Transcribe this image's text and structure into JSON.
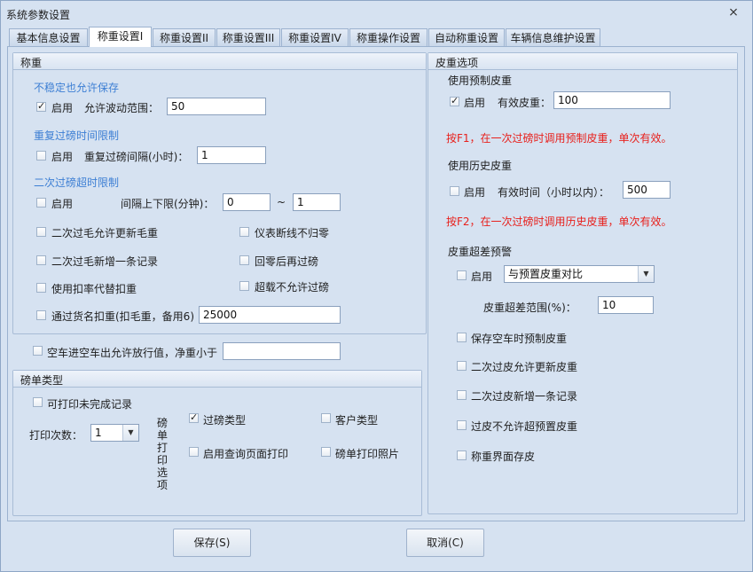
{
  "window": {
    "title": "系统参数设置",
    "close": "⨯"
  },
  "tabs": [
    "基本信息设置",
    "称重设置I",
    "称重设置II",
    "称重设置III",
    "称重设置IV",
    "称重操作设置",
    "自动称重设置",
    "车辆信息维护设置"
  ],
  "weighing": {
    "title": "称重",
    "unstable": {
      "heading": "不稳定也允许保存",
      "enable_label": "启用",
      "enabled": true,
      "range_label": "允许波动范围：",
      "range_value": "50"
    },
    "repeat": {
      "heading": "重复过磅时间限制",
      "enable_label": "启用",
      "enabled": false,
      "interval_label": "重复过磅间隔(小时)：",
      "interval_value": "1"
    },
    "second": {
      "heading": "二次过磅超时限制",
      "enable_label": "启用",
      "enabled": false,
      "range_label": "间隔上下限(分钟)：",
      "min_value": "0",
      "tilde": "~",
      "max_value": "1"
    },
    "options": {
      "update_gross": "二次过毛允许更新毛重",
      "new_gross_record": "二次过毛新增一条记录",
      "use_deduction_rate": "使用扣率代替扣重",
      "deduct_by_goods": "通过货名扣重(扣毛重，备用6)",
      "deduct_by_goods_value": "25000",
      "meter_disconnect": "仪表断线不归零",
      "rezero_then_weigh": "回零后再过磅",
      "overload_forbid": "超载不允许过磅"
    }
  },
  "empty_vehicle": {
    "label": "空车进空车出允许放行值，净重小于",
    "value": ""
  },
  "ticket": {
    "title": "磅单类型",
    "print_unfinished": "可打印未完成记录",
    "print_count_label": "打印次数：",
    "print_count_value": "1",
    "vertical_label": [
      "磅",
      "单",
      "打",
      "印",
      "选",
      "项"
    ],
    "weigh_type": "过磅类型",
    "weigh_type_checked": true,
    "customer_type": "客户类型",
    "query_page_print": "启用查询页面打印",
    "print_photo": "磅单打印照片"
  },
  "tare": {
    "title": "皮重选项",
    "preset": {
      "heading": "使用预制皮重",
      "enable_label": "启用",
      "enabled": true,
      "valid_label": "有效皮重：",
      "valid_value": "100",
      "hint": "按F1，在一次过磅时调用预制皮重，单次有效。"
    },
    "history": {
      "heading": "使用历史皮重",
      "enable_label": "启用",
      "enabled": false,
      "time_label": "有效时间（小时以内）：",
      "time_value": "500",
      "hint": "按F2，在一次过磅时调用历史皮重，单次有效。"
    },
    "warning": {
      "heading": "皮重超差预警",
      "enable_label": "启用",
      "enabled": false,
      "compare_value": "与预置皮重对比",
      "range_label": "皮重超差范围(%)：",
      "range_value": "10"
    },
    "options": {
      "save_preset_empty": "保存空车时预制皮重",
      "update_tare": "二次过皮允许更新皮重",
      "new_tare_record": "二次过皮新增一条记录",
      "no_exceed_preset": "过皮不允许超预置皮重",
      "weigh_ui_save_tare": "称重界面存皮"
    }
  },
  "buttons": {
    "save": "保存(S)",
    "cancel": "取消(C)"
  },
  "colors": {
    "background": "#d6e2f1",
    "blue_heading": "#3d7fd4",
    "red_hint": "#e8201c"
  }
}
